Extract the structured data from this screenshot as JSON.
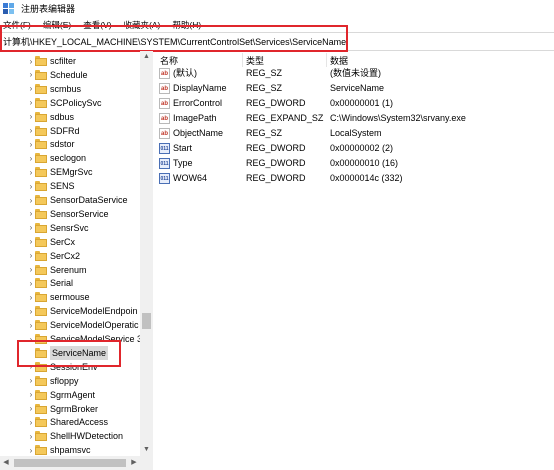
{
  "window": {
    "title": "注册表编辑器"
  },
  "menu": [
    "文件(F)",
    "编辑(E)",
    "查看(V)",
    "收藏夹(A)",
    "帮助(H)"
  ],
  "address": "计算机\\HKEY_LOCAL_MACHINE\\SYSTEM\\CurrentControlSet\\Services\\ServiceName",
  "tree": {
    "items": [
      {
        "label": "scfilter",
        "expandable": true
      },
      {
        "label": "Schedule",
        "expandable": true
      },
      {
        "label": "scmbus",
        "expandable": true
      },
      {
        "label": "SCPolicySvc",
        "expandable": true
      },
      {
        "label": "sdbus",
        "expandable": true
      },
      {
        "label": "SDFRd",
        "expandable": true
      },
      {
        "label": "sdstor",
        "expandable": true
      },
      {
        "label": "seclogon",
        "expandable": true
      },
      {
        "label": "SEMgrSvc",
        "expandable": true
      },
      {
        "label": "SENS",
        "expandable": true
      },
      {
        "label": "SensorDataService",
        "expandable": true
      },
      {
        "label": "SensorService",
        "expandable": true
      },
      {
        "label": "SensrSvc",
        "expandable": true
      },
      {
        "label": "SerCx",
        "expandable": true
      },
      {
        "label": "SerCx2",
        "expandable": true
      },
      {
        "label": "Serenum",
        "expandable": true
      },
      {
        "label": "Serial",
        "expandable": true
      },
      {
        "label": "sermouse",
        "expandable": true
      },
      {
        "label": "ServiceModelEndpoin",
        "expandable": true
      },
      {
        "label": "ServiceModelOperatic",
        "expandable": true
      },
      {
        "label": "ServiceModelService 3",
        "expandable": true
      },
      {
        "label": "ServiceName",
        "expandable": false,
        "selected": true
      },
      {
        "label": "SessionEnv",
        "expandable": true
      },
      {
        "label": "sfloppy",
        "expandable": true
      },
      {
        "label": "SgrmAgent",
        "expandable": true
      },
      {
        "label": "SgrmBroker",
        "expandable": true
      },
      {
        "label": "SharedAccess",
        "expandable": true
      },
      {
        "label": "ShellHWDetection",
        "expandable": true
      },
      {
        "label": "shpamsvc",
        "expandable": true
      }
    ]
  },
  "values": {
    "columns": {
      "name": "名称",
      "type": "类型",
      "data": "数据"
    },
    "rows": [
      {
        "icon": "string-value-icon",
        "kind": "sz",
        "glyph": "ab",
        "name": "(默认)",
        "type": "REG_SZ",
        "data": "(数值未设置)"
      },
      {
        "icon": "string-value-icon",
        "kind": "sz",
        "glyph": "ab",
        "name": "DisplayName",
        "type": "REG_SZ",
        "data": "ServiceName"
      },
      {
        "icon": "string-value-icon",
        "kind": "sz",
        "glyph": "ab",
        "name": "ErrorControl",
        "type": "REG_DWORD",
        "data": "0x00000001 (1)"
      },
      {
        "icon": "string-value-icon",
        "kind": "sz",
        "glyph": "ab",
        "name": "ImagePath",
        "type": "REG_EXPAND_SZ",
        "data": "C:\\Windows\\System32\\srvany.exe"
      },
      {
        "icon": "string-value-icon",
        "kind": "sz",
        "glyph": "ab",
        "name": "ObjectName",
        "type": "REG_SZ",
        "data": "LocalSystem"
      },
      {
        "icon": "dword-value-icon",
        "kind": "dword",
        "glyph": "011",
        "name": "Start",
        "type": "REG_DWORD",
        "data": "0x00000002 (2)"
      },
      {
        "icon": "dword-value-icon",
        "kind": "dword",
        "glyph": "011",
        "name": "Type",
        "type": "REG_DWORD",
        "data": "0x00000010 (16)"
      },
      {
        "icon": "dword-value-icon",
        "kind": "dword",
        "glyph": "011",
        "name": "WOW64",
        "type": "REG_DWORD",
        "data": "0x0000014c (332)"
      }
    ]
  },
  "colors": {
    "highlight_box": "#e0262c",
    "selection": "#d9d9d9",
    "folder": "#f4c85a"
  },
  "scroll_glyphs": {
    "up": "▲",
    "down": "▼",
    "left": "◀",
    "right": "▶"
  }
}
